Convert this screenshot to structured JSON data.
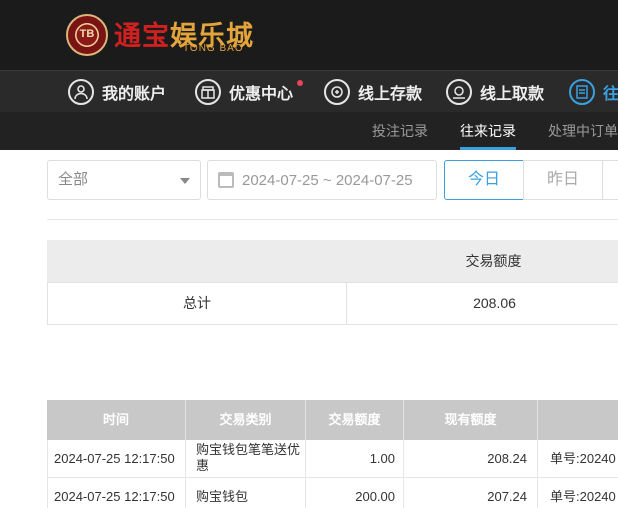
{
  "logo": {
    "coin_text": "TB",
    "main_text_1": "通",
    "main_text_2": "宝",
    "main_text_3": "娱乐城",
    "sub_text": "TONG BAO"
  },
  "main_nav": {
    "items": [
      {
        "label": "我的账户",
        "icon": "user-icon"
      },
      {
        "label": "优惠中心",
        "icon": "gift-icon",
        "has_dot": true
      },
      {
        "label": "线上存款",
        "icon": "deposit-icon"
      },
      {
        "label": "线上取款",
        "icon": "withdraw-icon"
      },
      {
        "label": "往",
        "icon": "records-icon",
        "active": true
      }
    ]
  },
  "sub_nav": {
    "items": [
      {
        "label": "投注记录"
      },
      {
        "label": "往来记录",
        "active": true
      },
      {
        "label": "处理中订单"
      }
    ]
  },
  "filters": {
    "type_select": "全部",
    "date_range": "2024-07-25 ~ 2024-07-25",
    "today": "今日",
    "yesterday": "昨日"
  },
  "summary": {
    "header": "交易额度",
    "row_label": "总计",
    "row_value": "208.06"
  },
  "records": {
    "headers": [
      "时间",
      "交易类别",
      "交易额度",
      "现有额度",
      ""
    ],
    "rows": [
      {
        "time": "2024-07-25 12:17:50",
        "type": "购宝钱包笔笔送优惠",
        "amount": "1.00",
        "balance": "208.24",
        "note": "单号:20240"
      },
      {
        "time": "2024-07-25 12:17:50",
        "type": "购宝钱包",
        "amount": "200.00",
        "balance": "207.24",
        "note": "单号:20240"
      }
    ]
  },
  "colors": {
    "accent": "#3aa0e0",
    "header_bg": "#1b1b1b",
    "nav_bg": "#2a2a2a",
    "notify_dot": "#e8455a",
    "logo_gold": "#e2a43b"
  }
}
